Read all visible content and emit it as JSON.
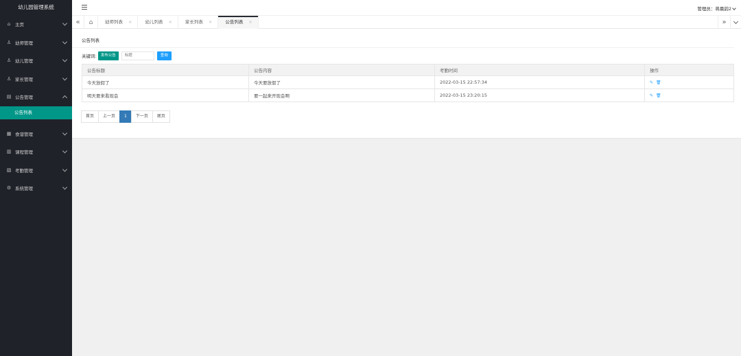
{
  "brand": "幼儿园管理系统",
  "sidebar": {
    "items": [
      {
        "label": "主页",
        "icon": "home-icon"
      },
      {
        "label": "幼师管理",
        "icon": "user-icon"
      },
      {
        "label": "幼儿管理",
        "icon": "user-icon"
      },
      {
        "label": "家长管理",
        "icon": "user-icon"
      },
      {
        "label": "公告管理",
        "icon": "notice-icon",
        "expanded": true,
        "sub": [
          "公告列表"
        ]
      },
      {
        "label": "食谱管理",
        "icon": "calendar-icon"
      },
      {
        "label": "课程管理",
        "icon": "book-icon"
      },
      {
        "label": "考勤管理",
        "icon": "check-icon"
      },
      {
        "label": "系统管理",
        "icon": "gear-icon"
      }
    ]
  },
  "topbar": {
    "admin_label": "管理员：蒋晨韵2"
  },
  "tabs": [
    {
      "label": "幼师列表",
      "active": false
    },
    {
      "label": "幼儿列表",
      "active": false
    },
    {
      "label": "家长列表",
      "active": false
    },
    {
      "label": "公告列表",
      "active": true
    }
  ],
  "page": {
    "title": "公告列表",
    "keyword_label": "关键词:",
    "publish_button": "发布公告",
    "search_placeholder": "标题",
    "query_button": "查询"
  },
  "table": {
    "headers": [
      "公告标题",
      "公告内容",
      "考勤时间",
      "操作"
    ],
    "rows": [
      {
        "title": "今天放假了",
        "content": "今天要放假了",
        "time": "2022-03-15 22:57:34"
      },
      {
        "title": "明天要来看现会",
        "content": "要一起来开现会啊",
        "time": "2022-03-15 23:20:15"
      }
    ]
  },
  "pager": {
    "first": "首页",
    "prev": "上一页",
    "current": "1",
    "next": "下一页",
    "last": "尾页"
  },
  "colors": {
    "sidebar_bg": "#20222a",
    "accent_green": "#009688",
    "accent_blue": "#1e9fff",
    "pager_current": "#337ab7"
  }
}
